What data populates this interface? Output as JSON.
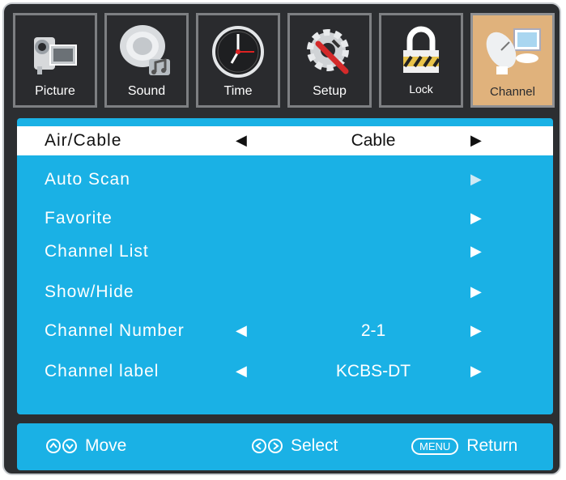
{
  "tabs": [
    {
      "label": "Picture",
      "icon": "camera-icon",
      "active": false
    },
    {
      "label": "Sound",
      "icon": "speaker-icon",
      "active": false
    },
    {
      "label": "Time",
      "icon": "clock-icon",
      "active": false
    },
    {
      "label": "Setup",
      "icon": "gear-wrench-icon",
      "active": false
    },
    {
      "label": "Lock",
      "icon": "lock-icon",
      "active": false
    },
    {
      "label": "Channel",
      "icon": "satellite-dish-icon",
      "active": true
    }
  ],
  "menu": {
    "items": [
      {
        "label": "Air/Cable",
        "left_arrow": "◀",
        "value": "Cable",
        "right_arrow": "▶"
      },
      {
        "label": "Auto Scan",
        "left_arrow": "",
        "value": "",
        "right_arrow": "▶"
      },
      {
        "label": "Favorite",
        "left_arrow": "",
        "value": "",
        "right_arrow": "▶"
      },
      {
        "label": "Channel List",
        "left_arrow": "",
        "value": "",
        "right_arrow": "▶"
      },
      {
        "label": "Show/Hide",
        "left_arrow": "",
        "value": "",
        "right_arrow": "▶"
      },
      {
        "label": "Channel Number",
        "left_arrow": "◀",
        "value": "2-1",
        "right_arrow": "▶"
      },
      {
        "label": "Channel label",
        "left_arrow": "◀",
        "value": "KCBS-DT",
        "right_arrow": "▶"
      }
    ]
  },
  "footer": {
    "move": "Move",
    "select": "Select",
    "menu_key": "MENU",
    "return": "Return"
  },
  "colors": {
    "panel": "#1ab1e5",
    "frame": "#2c2e31",
    "active_tab": "#e0b27c"
  }
}
